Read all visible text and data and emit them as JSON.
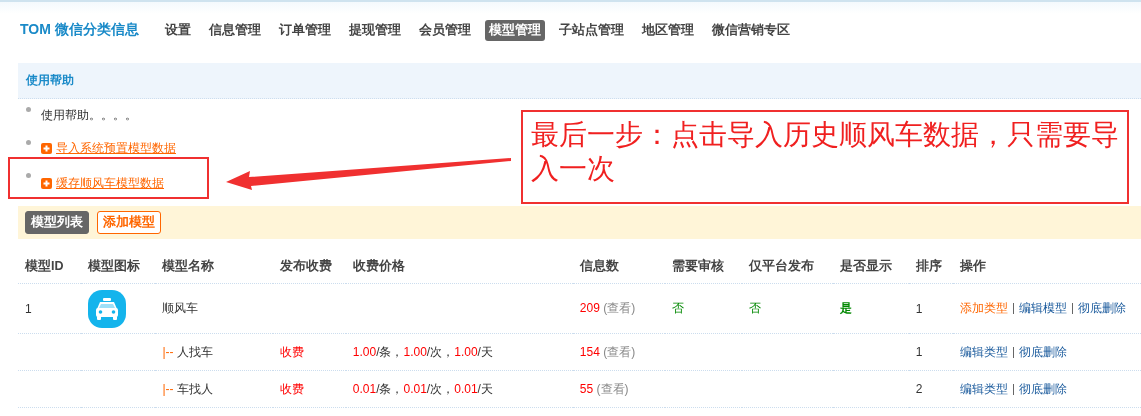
{
  "header": {
    "logo": "TOM 微信分类信息",
    "nav": [
      {
        "label": "设置",
        "selected": false
      },
      {
        "label": "信息管理",
        "selected": false
      },
      {
        "label": "订单管理",
        "selected": false
      },
      {
        "label": "提现管理",
        "selected": false
      },
      {
        "label": "会员管理",
        "selected": false
      },
      {
        "label": "模型管理",
        "selected": true
      },
      {
        "label": "子站点管理",
        "selected": false
      },
      {
        "label": "地区管理",
        "selected": false
      },
      {
        "label": "微信营销专区",
        "selected": false
      }
    ]
  },
  "help": {
    "title": "使用帮助",
    "items": [
      {
        "kind": "text",
        "label": "使用帮助。。。。"
      },
      {
        "kind": "link",
        "label": "导入系统预置模型数据"
      },
      {
        "kind": "link",
        "label": "缓存顺风车模型数据"
      }
    ]
  },
  "annotation": {
    "text": "最后一步：点击导入历史顺风车数据，只需要导入一次"
  },
  "toolbar": [
    {
      "label": "模型列表",
      "selected": true
    },
    {
      "label": "添加模型",
      "selected": false
    }
  ],
  "table": {
    "columns": [
      "模型ID",
      "模型图标",
      "模型名称",
      "发布收费",
      "收费价格",
      "信息数",
      "需要审核",
      "仅平台发布",
      "是否显示",
      "排序",
      "操作"
    ],
    "rows": [
      {
        "kind": "model",
        "id": "1",
        "name": "顺风车",
        "count": "209",
        "view": "(查看)",
        "review": "否",
        "platform_only": "否",
        "show": "是",
        "sort": "1",
        "actions": [
          {
            "label": "添加类型",
            "kind": "add"
          },
          {
            "label": "编辑模型",
            "kind": "edit"
          },
          {
            "label": "彻底删除",
            "kind": "delete"
          }
        ]
      },
      {
        "kind": "type",
        "prefix": "|--",
        "name": "人找车",
        "fee": "收费",
        "price": [
          {
            "text": "1.00",
            "kind": "amount"
          },
          {
            "text": "/条，",
            "kind": "unit"
          },
          {
            "text": "1.00",
            "kind": "amount"
          },
          {
            "text": "/次，",
            "kind": "unit"
          },
          {
            "text": "1.00",
            "kind": "amount"
          },
          {
            "text": "/天",
            "kind": "unit"
          }
        ],
        "count": "154",
        "view": "(查看)",
        "sort": "1",
        "actions": [
          {
            "label": "编辑类型",
            "kind": "edit"
          },
          {
            "label": "彻底删除",
            "kind": "delete"
          }
        ]
      },
      {
        "kind": "type",
        "prefix": "|--",
        "name": "车找人",
        "fee": "收费",
        "price": [
          {
            "text": "0.01",
            "kind": "amount"
          },
          {
            "text": "/条，",
            "kind": "unit"
          },
          {
            "text": "0.01",
            "kind": "amount"
          },
          {
            "text": "/次，",
            "kind": "unit"
          },
          {
            "text": "0.01",
            "kind": "amount"
          },
          {
            "text": "/天",
            "kind": "unit"
          }
        ],
        "count": "55",
        "view": "(查看)",
        "sort": "2",
        "actions": [
          {
            "label": "编辑类型",
            "kind": "edit"
          },
          {
            "label": "彻底删除",
            "kind": "delete"
          }
        ]
      }
    ]
  }
}
